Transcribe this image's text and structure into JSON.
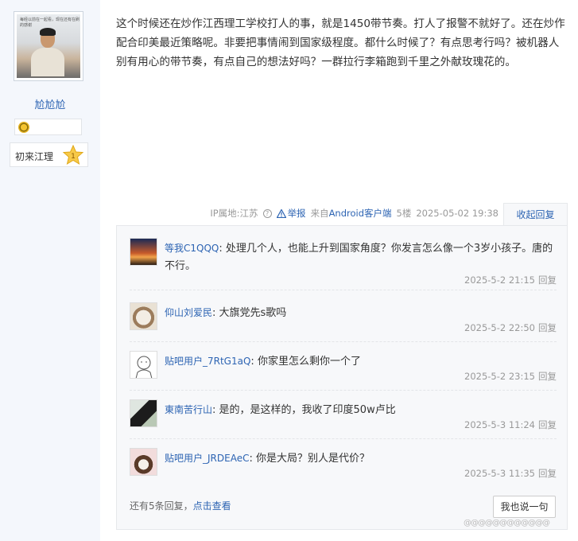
{
  "author": {
    "avatar_caption": "每经以前在一起看，现在还有在刷的感谢",
    "name": "尬尬尬",
    "level_label": "初来江理",
    "level_number": "1"
  },
  "post": {
    "text": "这个时候还在炒作江西理工学校打人的事，就是1450带节奏。打人了报警不就好了。还在炒作配合印美最近策略呢。非要把事情闹到国家级程度。都什么时候了？有点思考行吗？被机器人别有用心的带节奏，有点自己的想法好吗？一群拉行李箱跑到千里之外献玫瑰花的。",
    "ip_location": "IP属地:江苏",
    "report_label": "举报",
    "client_prefix": "来自",
    "client_name": "Android客户端",
    "floor": "5楼",
    "time": "2025-05-02 19:38",
    "collapse_label": "收起回复"
  },
  "replies": [
    {
      "user": "等我C1QQQ",
      "text": "处理几个人，也能上升到国家角度？你发言怎么像一个3岁小孩子。唐的不行。",
      "time": "2025-5-2 21:15",
      "reply_label": "回复"
    },
    {
      "user": "仰山刘爱民",
      "text": "大旗党先s歌吗",
      "time": "2025-5-2 22:50",
      "reply_label": "回复"
    },
    {
      "user": "贴吧用户_7RtG1aQ",
      "text": "你家里怎么剩你一个了",
      "time": "2025-5-2 23:15",
      "reply_label": "回复"
    },
    {
      "user": "東南苦行山",
      "text": "是的，是这样的，我收了印度50w卢比",
      "time": "2025-5-3 11:24",
      "reply_label": "回复"
    },
    {
      "user": "贴吧用户_JRDEAeC",
      "text": "你是大局？别人是代价？",
      "time": "2025-5-3 11:35",
      "reply_label": "回复"
    }
  ],
  "more": {
    "prefix": "还有5条回复，",
    "link": "点击查看"
  },
  "say_button": "我也说一句",
  "watermark": "@@@@@@@@@@@@",
  "colors": {
    "link": "#2d64b3",
    "sidebar_bg": "#f4f7fc",
    "reply_bg": "#f7f8fa"
  }
}
